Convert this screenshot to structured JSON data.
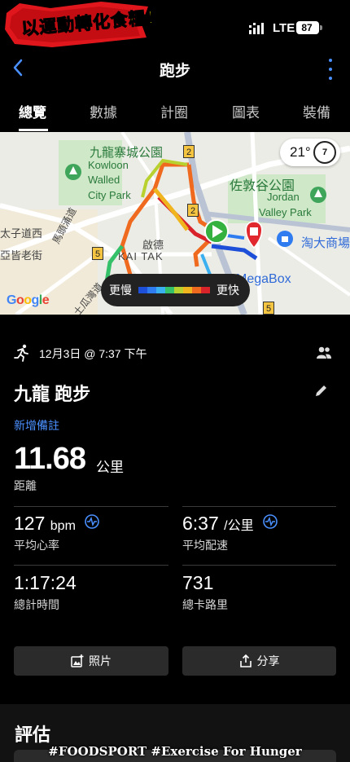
{
  "status_bar": {
    "brand_banner_text": "以運動轉化食糧！",
    "network": "LTE",
    "battery": "87"
  },
  "header": {
    "title": "跑步"
  },
  "tabs": [
    {
      "label": "總覽",
      "active": true
    },
    {
      "label": "數據",
      "active": false
    },
    {
      "label": "計圈",
      "active": false
    },
    {
      "label": "圖表",
      "active": false
    },
    {
      "label": "裝備",
      "active": false
    }
  ],
  "map": {
    "labels": {
      "kowloon_walled_city_park_zh": "九龍寨城公園",
      "kowloon": "Kowloon",
      "walled": "Walled",
      "city_park": "City Park",
      "jordan_valley_park_zh": "佐敦谷公園",
      "jordan": "Jordan",
      "valley_park": "Valley Park",
      "kai_tak_zh": "啟德",
      "kai_tak": "KAI TAK",
      "megabox": "MegaBox",
      "taodashop": "淘大商場",
      "prince_edward_road": "太子道西",
      "argyle_street": "亞皆老街",
      "ma_tau_chung_road": "馬頭涌道",
      "to_kwa_wan_road": "土瓜灣道",
      "route_2a": "2",
      "route_2b": "2",
      "route_5a": "5",
      "route_5b": "5"
    },
    "temperature": "21°",
    "uv_index": "7",
    "legend": {
      "slow": "更慢",
      "fast": "更快",
      "colors": [
        "#1d4fd8",
        "#2f7cf0",
        "#3ab0f0",
        "#35c06a",
        "#b9d12e",
        "#f0b51e",
        "#ef6a1f",
        "#d8232a"
      ]
    },
    "attribution": "Google"
  },
  "activity": {
    "date": "12月3日 @ 7:37 下午",
    "title": "九龍 跑步",
    "add_note": "新增備註",
    "distance": {
      "value": "11.68",
      "unit": "公里",
      "label": "距離"
    },
    "stats": {
      "avg_hr": {
        "value": "127",
        "unit": "bpm",
        "label": "平均心率"
      },
      "avg_pace": {
        "value": "6:37",
        "unit": "/公里",
        "label": "平均配速"
      },
      "total_time": {
        "value": "1:17:24",
        "label": "總計時間"
      },
      "calories": {
        "value": "731",
        "label": "總卡路里"
      }
    }
  },
  "buttons": {
    "photos": "照片",
    "share": "分享"
  },
  "evaluation": {
    "title": "評估"
  },
  "watermark": "#FOODSPORT #Exercise For Hunger",
  "colors": {
    "accent": "#4a90ff",
    "background": "#000000",
    "button_bg": "#2b2b2b"
  }
}
